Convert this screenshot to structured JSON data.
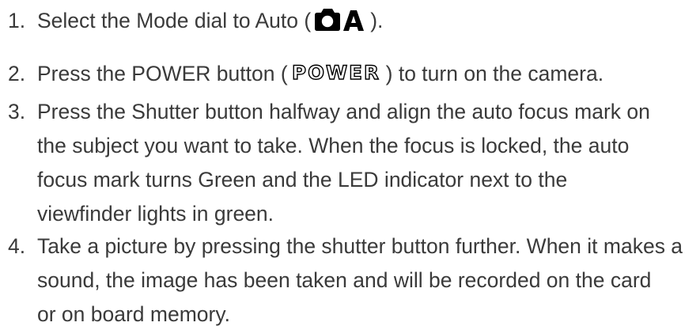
{
  "steps": [
    {
      "number": "1.",
      "lines": [
        {
          "before": "Select the Mode dial to Auto (",
          "after": ")."
        }
      ],
      "icon": "camera-auto-mode-icon"
    },
    {
      "number": "2.",
      "lines": [
        {
          "before": "Press the POWER button (",
          "after": ")  to turn on the camera."
        }
      ],
      "icon": "power-button-icon",
      "icon_text": "POWER"
    },
    {
      "number": "3.",
      "lines": [
        "Press the Shutter button halfway and align the auto focus mark on",
        "the subject you want to take. When the focus is locked, the auto",
        "focus mark turns Green and the LED indicator next to the",
        "viewfinder lights in green."
      ]
    },
    {
      "number": "4.",
      "lines": [
        "Take a picture by pressing the shutter button further. When it makes a",
        "sound, the image has been taken and will be recorded on the card",
        "or on board memory."
      ]
    }
  ],
  "colors": {
    "text": "#3a3a3a",
    "icon_fill": "#000000"
  }
}
